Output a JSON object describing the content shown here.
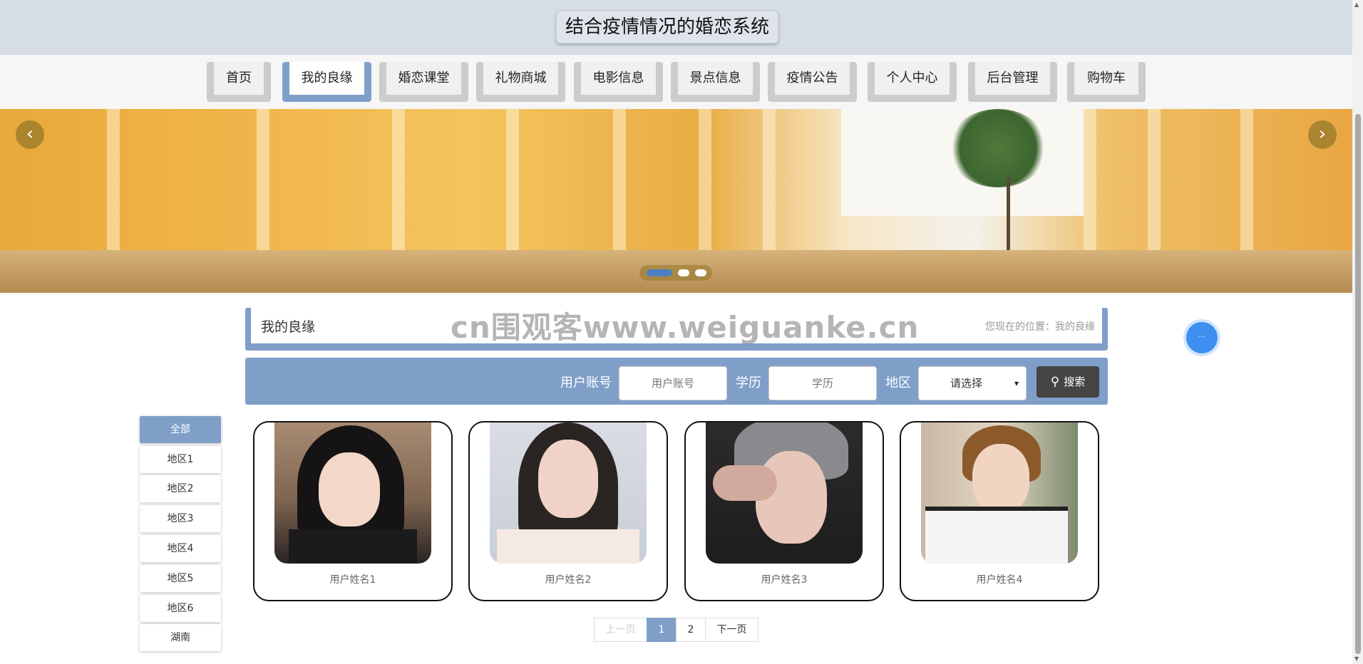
{
  "header": {
    "title": "结合疫情情况的婚恋系统"
  },
  "nav": {
    "items": [
      {
        "label": "首页"
      },
      {
        "label": "我的良缘"
      },
      {
        "label": "婚恋课堂"
      },
      {
        "label": "礼物商城"
      },
      {
        "label": "电影信息"
      },
      {
        "label": "景点信息"
      },
      {
        "label": "疫情公告"
      },
      {
        "label": "个人中心"
      },
      {
        "label": "后台管理"
      },
      {
        "label": "购物车"
      }
    ],
    "active_index": 1
  },
  "carousel": {
    "prev_icon": "‹",
    "next_icon": "›",
    "slides": 3,
    "active_slide": 1
  },
  "page": {
    "title": "我的良缘",
    "location": "您现在的位置：我的良缘",
    "watermark": "cn围观客www.weiguanke.cn"
  },
  "search": {
    "account_label": "用户账号",
    "account_placeholder": "用户账号",
    "education_label": "学历",
    "education_placeholder": "学历",
    "region_label": "地区",
    "region_selected": "请选择",
    "button_label": "搜索",
    "button_icon": "search-icon"
  },
  "sidebar": {
    "items": [
      {
        "label": "全部"
      },
      {
        "label": "地区1"
      },
      {
        "label": "地区2"
      },
      {
        "label": "地区3"
      },
      {
        "label": "地区4"
      },
      {
        "label": "地区5"
      },
      {
        "label": "地区6"
      },
      {
        "label": "湖南"
      }
    ],
    "active_index": 0
  },
  "users": [
    {
      "name": "用户姓名1"
    },
    {
      "name": "用户姓名2"
    },
    {
      "name": "用户姓名3"
    },
    {
      "name": "用户姓名4"
    }
  ],
  "pagination": {
    "prev": "上一页",
    "pages": [
      "1",
      "2"
    ],
    "current": "1",
    "next": "下一页"
  },
  "colors": {
    "accent": "#7f9fc9",
    "header_bg": "#d6dde7",
    "search_button": "#444444"
  }
}
